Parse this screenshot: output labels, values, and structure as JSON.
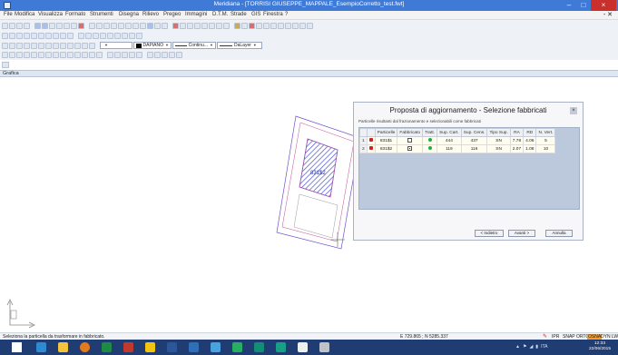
{
  "window": {
    "title": "Meridiana - [TORRISI GIUSEPPE_MAPPALE_EsempioCorretto_test.fwt]",
    "min_label": "–",
    "max_label": "□",
    "close_label": "×"
  },
  "menu": {
    "items": [
      "File",
      "Modifica",
      "Visualizza",
      "Formato",
      "Strumenti",
      "Disegna",
      "Rilievo",
      "Pregeo",
      "Immagini",
      "D.T.M.",
      "Strade",
      "GIS",
      "Finestra",
      "?"
    ],
    "right_mark": "- ✕"
  },
  "toolbar": {
    "layer_combo": "DAPIANO",
    "linetype_combo": "Continu...",
    "lineweight_combo": "DaLayer"
  },
  "panel": {
    "label": "Grafica"
  },
  "dialog": {
    "title": "Proposta di aggiornamento - Selezione fabbricati",
    "close": "×",
    "subtitle": "Particelle risultanti dal frazionamento e selezionabili come fabbricati",
    "columns": [
      "",
      "",
      "Particelle",
      "Fabbricato",
      "Tratt.",
      "Sup. Cart.",
      "Sup. Cens.",
      "Tipo Sup.",
      "RA",
      "RD",
      "N. Vert."
    ],
    "rows": [
      {
        "n": "1",
        "particella": "831$1",
        "fabbricato": false,
        "sup_cart": "444",
        "sup_cens": "437",
        "tipo_sup": "SN",
        "ra": "7.78",
        "rd": "4.06",
        "n_vert": "5"
      },
      {
        "n": "2",
        "particella": "831$2",
        "fabbricato": true,
        "sup_cart": "119",
        "sup_cens": "116",
        "tipo_sup": "SN",
        "ra": "2.07",
        "rd": "1.08",
        "n_vert": "10"
      }
    ],
    "buttons": {
      "back": "< Indietro",
      "next": "Avanti >",
      "cancel": "Annulla"
    }
  },
  "canvas": {
    "parcel_label": "831$2",
    "crosshair": "+"
  },
  "status": {
    "message": "Seleziona la particella da trasformare in fabbricato.",
    "coords": "E  729.865 ; N  5285.337",
    "modes": [
      "IPR",
      "SNAP",
      "ORTO"
    ],
    "osna": "OSNA",
    "dyn": "DYN",
    "lw": "LW"
  },
  "taskbar": {
    "lang": "ITA",
    "time": "12:33",
    "date": "22/06/2015"
  },
  "colors": {
    "title_blue": "#3f7ad6",
    "taskbar_blue": "#1f3c73",
    "parcel_hatch": "#4a52d6",
    "parcel_outline": "#c74a8e",
    "status_red": "#d32020",
    "status_green": "#19b23b"
  }
}
